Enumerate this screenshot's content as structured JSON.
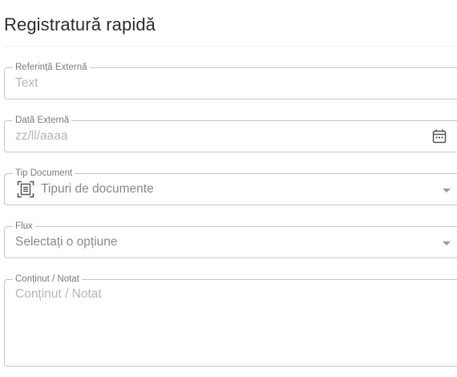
{
  "form": {
    "title": "Registratură rapidă",
    "fields": {
      "external_reference": {
        "label": "Referință Externă",
        "placeholder": "Text",
        "value": ""
      },
      "external_date": {
        "label": "Dată Externă",
        "placeholder": "zz/ll/aaaa",
        "value": "",
        "icon": "calendar-icon"
      },
      "document_type": {
        "label": "Tip Document",
        "selected": "Tipuri de documente",
        "icon": "document-scan-icon"
      },
      "flow": {
        "label": "Flux",
        "selected": "Selectați o opțiune"
      },
      "content_note": {
        "label": "Conținut / Notat",
        "placeholder": "Conținut / Notat",
        "value": ""
      }
    }
  },
  "colors": {
    "border": "#c6c6c6",
    "label": "#7a7a7a",
    "placeholder": "#b6b6b6",
    "selected_text": "#888888",
    "icon": "#555555",
    "title": "#2b2b2b"
  }
}
